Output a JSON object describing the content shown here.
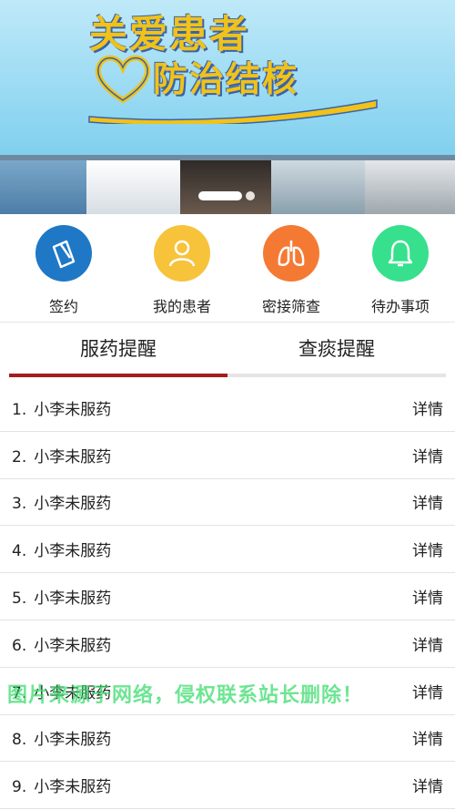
{
  "banner": {
    "title_line1": "关爱患者",
    "title_line2": "防治结核"
  },
  "actions": [
    {
      "label": "签约",
      "icon": "sign-document-icon",
      "color": "#1f78c6"
    },
    {
      "label": "我的患者",
      "icon": "user-icon",
      "color": "#f6c33b"
    },
    {
      "label": "密接筛查",
      "icon": "lungs-icon",
      "color": "#f47a34"
    },
    {
      "label": "待办事项",
      "icon": "bell-icon",
      "color": "#36e08c"
    }
  ],
  "tabs": [
    {
      "label": "服药提醒",
      "active": true
    },
    {
      "label": "查痰提醒",
      "active": false
    }
  ],
  "accent_color": "#a31d1d",
  "list": [
    {
      "num": "1.",
      "text": "小李未服药",
      "action": "详情"
    },
    {
      "num": "2.",
      "text": "小李未服药",
      "action": "详情"
    },
    {
      "num": "3.",
      "text": "小李未服药",
      "action": "详情"
    },
    {
      "num": "4.",
      "text": "小李未服药",
      "action": "详情"
    },
    {
      "num": "5.",
      "text": "小李未服药",
      "action": "详情"
    },
    {
      "num": "6.",
      "text": "小李未服药",
      "action": "详情"
    },
    {
      "num": "7.",
      "text": "小李未服药",
      "action": "详情"
    },
    {
      "num": "8.",
      "text": "小李未服药",
      "action": "详情"
    },
    {
      "num": "9.",
      "text": "小李未服药",
      "action": "详情"
    }
  ],
  "watermark": "图片来源于网络，侵权联系站长删除！"
}
